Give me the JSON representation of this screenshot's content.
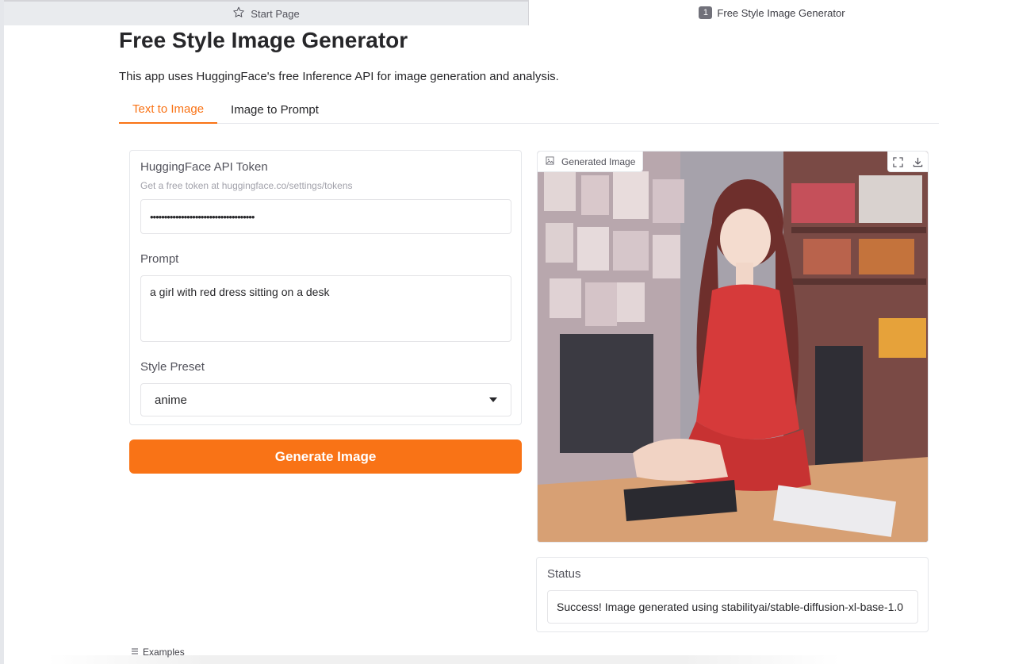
{
  "browser_tabs": {
    "start_page": {
      "label": "Start Page",
      "icon": "star-icon"
    },
    "app_tab": {
      "number": "1",
      "label": "Free Style Image Generator"
    }
  },
  "app": {
    "title": "Free Style Image Generator",
    "description": "This app uses HuggingFace's free Inference API for image generation and analysis."
  },
  "tabs": [
    {
      "label": "Text to Image",
      "selected": true
    },
    {
      "label": "Image to Prompt",
      "selected": false
    }
  ],
  "form": {
    "token_label": "HuggingFace API Token",
    "token_info": "Get a free token at huggingface.co/settings/tokens",
    "token_value": "•••••••••••••••••••••••••••••••••••••",
    "prompt_label": "Prompt",
    "prompt_value": "a girl with red dress sitting on a desk",
    "style_label": "Style Preset",
    "style_value": "anime"
  },
  "generate_button": "Generate Image",
  "output": {
    "image_label": "Generated Image",
    "icons": [
      "image-icon",
      "fullscreen-icon",
      "download-icon"
    ]
  },
  "status": {
    "label": "Status",
    "value": "Success! Image generated using stabilityai/stable-diffusion-xl-base-1.0"
  },
  "examples_label": "Examples",
  "colors": {
    "accent": "#f97316",
    "border": "#e5e7eb"
  }
}
